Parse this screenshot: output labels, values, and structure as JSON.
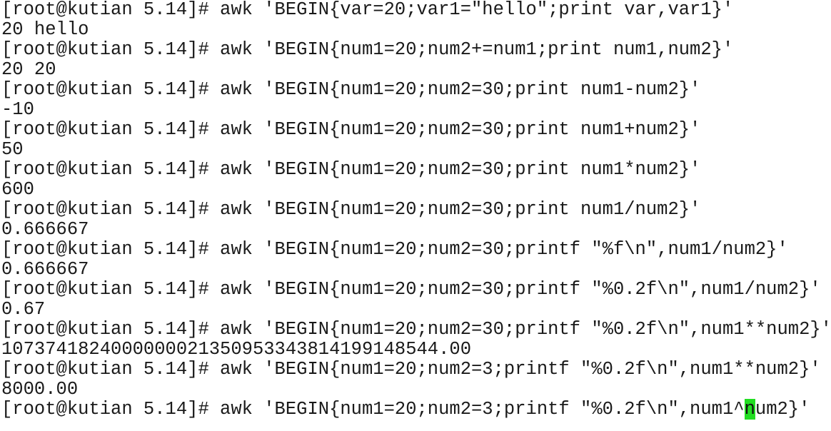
{
  "terminal": {
    "lines": [
      "[root@kutian 5.14]# awk 'BEGIN{var=20;var1=\"hello\";print var,var1}'",
      "20 hello",
      "[root@kutian 5.14]# awk 'BEGIN{num1=20;num2+=num1;print num1,num2}'",
      "20 20",
      "[root@kutian 5.14]# awk 'BEGIN{num1=20;num2=30;print num1-num2}'",
      "-10",
      "[root@kutian 5.14]# awk 'BEGIN{num1=20;num2=30;print num1+num2}'",
      "50",
      "[root@kutian 5.14]# awk 'BEGIN{num1=20;num2=30;print num1*num2}'",
      "600",
      "[root@kutian 5.14]# awk 'BEGIN{num1=20;num2=30;print num1/num2}'",
      "0.666667",
      "[root@kutian 5.14]# awk 'BEGIN{num1=20;num2=30;printf \"%f\\n\",num1/num2}'",
      "0.666667",
      "[root@kutian 5.14]# awk 'BEGIN{num1=20;num2=30;printf \"%0.2f\\n\",num1/num2}'",
      "0.67",
      "[root@kutian 5.14]# awk 'BEGIN{num1=20;num2=30;printf \"%0.2f\\n\",num1**num2}'",
      "1073741824000000021350953343814199148544.00",
      "[root@kutian 5.14]# awk 'BEGIN{num1=20;num2=3;printf \"%0.2f\\n\",num1**num2}'",
      "8000.00"
    ],
    "current_line": {
      "before_cursor": "[root@kutian 5.14]# awk 'BEGIN{num1=20;num2=3;printf \"%0.2f\\n\",num1^",
      "cursor_char": "n",
      "after_cursor": "um2}'"
    },
    "cursor_color": "#22dd22"
  }
}
